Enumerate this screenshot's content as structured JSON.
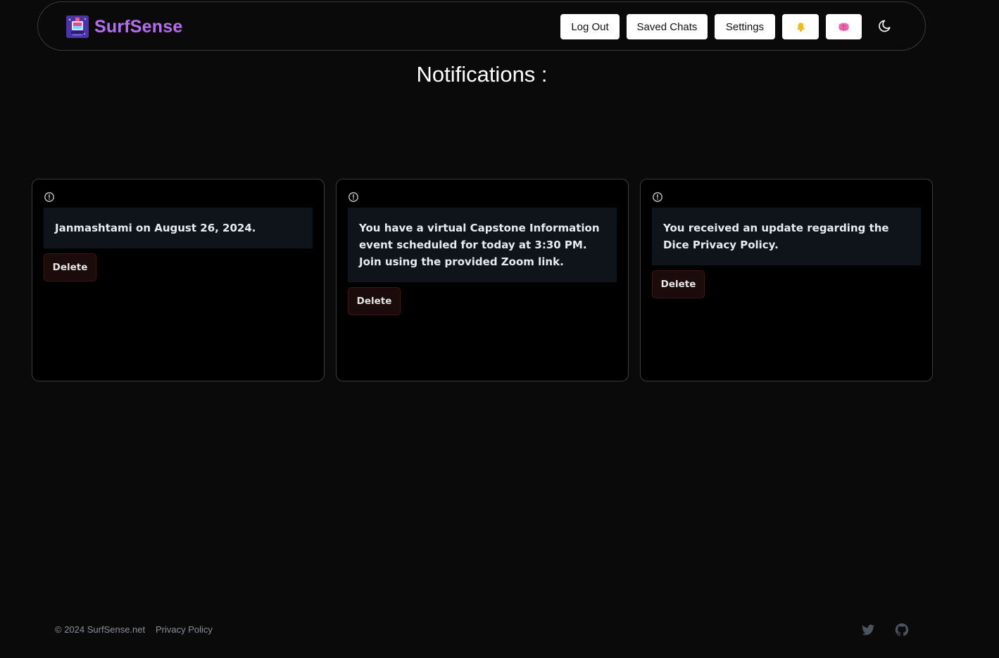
{
  "header": {
    "brand": "SurfSense",
    "buttons": {
      "logout": "Log Out",
      "saved_chats": "Saved Chats",
      "settings": "Settings",
      "notifications_icon": "bell-icon",
      "brain_icon": "brain-icon"
    },
    "theme_icon": "moon-icon"
  },
  "page": {
    "title": "Notifications :"
  },
  "notifications": [
    {
      "message": "Janmashtami on August 26, 2024.",
      "delete_label": "Delete"
    },
    {
      "message": "You have a virtual Capstone Information event scheduled for today at 3:30 PM. Join using the provided Zoom link.",
      "delete_label": "Delete"
    },
    {
      "message": "You received an update regarding the Dice Privacy Policy.",
      "delete_label": "Delete"
    }
  ],
  "footer": {
    "copyright": "© 2024 SurfSense.net",
    "privacy": "Privacy Policy",
    "social_icons": [
      "twitter-icon",
      "github-icon"
    ]
  },
  "colors": {
    "background": "#0a0a0a",
    "brand": "#b56ef0",
    "card_bg": "#000000",
    "message_bg": "#0f131a",
    "delete_bg": "#1c0b0b"
  }
}
